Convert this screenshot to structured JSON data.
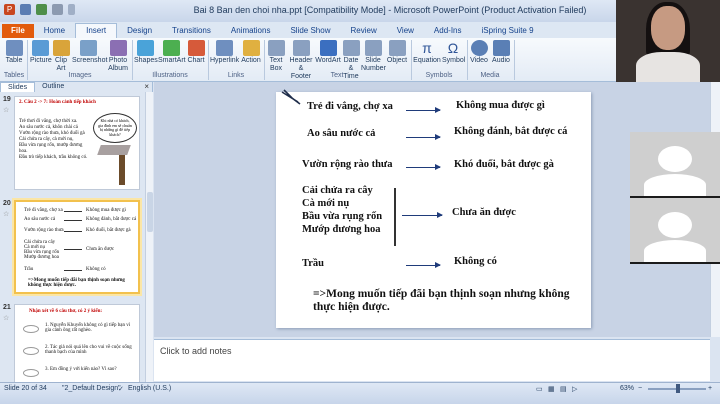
{
  "window": {
    "title": "Bai 8 Ban den choi nha.ppt [Compatibility Mode] - Microsoft PowerPoint (Product Activation Failed)",
    "controls": [
      "—",
      "▫",
      "✕"
    ]
  },
  "qat": {
    "app_letter": "P"
  },
  "tabs": [
    "File",
    "Home",
    "Insert",
    "Design",
    "Transitions",
    "Animations",
    "Slide Show",
    "Review",
    "View",
    "Add-Ins",
    "iSpring Suite 9"
  ],
  "active_tab": "Insert",
  "ribbon": {
    "groups": [
      {
        "label": "Tables"
      },
      {
        "label": "Images"
      },
      {
        "label": "Illustrations"
      },
      {
        "label": "Links"
      },
      {
        "label": "Text"
      },
      {
        "label": "Symbols"
      },
      {
        "label": "Media"
      }
    ],
    "buttons": [
      {
        "label": "Table",
        "color": "#6f8fbf"
      },
      {
        "label": "Picture",
        "color": "#5a9bd5"
      },
      {
        "label": "Clip Art",
        "color": "#d9a43a"
      },
      {
        "label": "Screenshot",
        "color": "#7aa0c8"
      },
      {
        "label": "Photo Album",
        "color": "#8b6fb3"
      },
      {
        "label": "Shapes",
        "color": "#4aa3d9"
      },
      {
        "label": "SmartArt",
        "color": "#4caf50"
      },
      {
        "label": "Chart",
        "color": "#d65a3a"
      },
      {
        "label": "Hyperlink",
        "color": "#6f8fbf"
      },
      {
        "label": "Action",
        "color": "#e0b040"
      },
      {
        "label": "Text Box",
        "color": "#8aa0c0"
      },
      {
        "label": "Header & Footer",
        "color": "#8aa0c0"
      },
      {
        "label": "WordArt",
        "color": "#3b6fc0"
      },
      {
        "label": "Date & Time",
        "color": "#8aa0c0"
      },
      {
        "label": "Slide Number",
        "color": "#8aa0c0"
      },
      {
        "label": "Object",
        "color": "#8aa0c0"
      },
      {
        "label": "Equation",
        "color": "#2f5597"
      },
      {
        "label": "Symbol",
        "color": "#2f5597"
      },
      {
        "label": "Video",
        "color": "#5a7fb5"
      },
      {
        "label": "Audio",
        "color": "#5a7fb5"
      }
    ],
    "icon_glyphs": {
      "Equation": "π",
      "Symbol": "Ω"
    }
  },
  "panel": {
    "tabs": [
      "Slides",
      "Outline"
    ],
    "close": "×"
  },
  "thumbnails": [
    {
      "num": "19",
      "title": "2. Câu 2 -> 7: Hoàn cảnh tiếp khách",
      "lines": [
        "Trẻ thơi đi vắng, chợ thời xa.",
        "Ao sâu nước cả, khôn chài cá",
        "Vườn rộng rào thưa, khó đuổi gà",
        "Cải chửa ra cây, cà mới nụ,",
        "Bầu vừa rụng rốn, mướp đương",
        "hoa.",
        "Đầu trò tiếp khách, trầu không có."
      ],
      "bubble": "Khi nhà có khách, gia đình em sẽ chuẩn bị những gì để tiếp khách?"
    },
    {
      "num": "20",
      "left": [
        "Trẻ đi vắng, chợ xa",
        "Ao sâu nước cả",
        "Vườn rộng rào thưa",
        "Cải chửa ra cây",
        "Cà mới nụ",
        "Bầu vừa rụng rốn",
        "Mướp đương hoa",
        "Trầu"
      ],
      "right": [
        "Không mua được gì",
        "Không đánh, bắt được cá",
        "Khó đuổi, bắt được gà",
        "Chưa ăn được",
        "Không có"
      ],
      "conclusion": "=>Mong muốn tiếp đãi bạn thịnh soạn nhưng không thực hiện được."
    },
    {
      "num": "21",
      "title": "Nhận xét về 6 câu thơ, có 2 ý kiến:",
      "items": [
        "1. Nguyễn Khuyến không có gì tiếp bạn vì gia cảnh ông rất nghèo.",
        "2. Tác giả nói quá lên cho vui về cuộc sống thanh bạch của mình",
        "3. Em đồng ý với kiến nào? Vì sao?"
      ]
    }
  ],
  "slide": {
    "rows": [
      {
        "left": "Trẻ đi vắng, chợ xa",
        "right": "Không mua được gì"
      },
      {
        "left": "Ao sâu nước cả",
        "right": "Không đánh, bắt được cá"
      },
      {
        "left": "Vườn rộng rào thưa",
        "right": "Khó đuổi, bắt được gà"
      },
      {
        "left_lines": [
          "Cải chửa ra cây",
          "Cà mới nụ",
          "Bầu vừa rụng rốn",
          "Mướp đương hoa"
        ],
        "right": "Chưa ăn được"
      },
      {
        "left": "Trầu",
        "right": "Không có"
      }
    ],
    "conclusion": "=>Mong muốn tiếp đãi bạn thịnh soạn nhưng không thực hiện được."
  },
  "notes": {
    "placeholder": "Click to add notes"
  },
  "status": {
    "slide": "Slide 20 of 34",
    "theme": "\"2_Default Design\"",
    "language": "English (U.S.)",
    "zoom": "63%"
  }
}
